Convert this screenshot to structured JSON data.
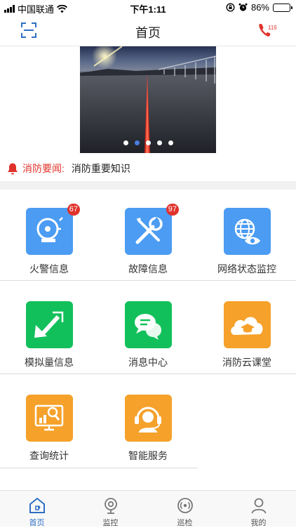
{
  "status_bar": {
    "carrier": "中国联通",
    "time": "下午1:11",
    "battery": "86%",
    "battery_level": 0.86
  },
  "nav": {
    "title": "首页",
    "phone_label": "119"
  },
  "banner": {
    "slide_count": 5,
    "active_slide": 2
  },
  "news": {
    "tag": "消防要闻:",
    "headline": "消防重要知识"
  },
  "grid": {
    "fire_alarm": {
      "label": "火警信息",
      "badge": "67"
    },
    "fault": {
      "label": "故障信息",
      "badge": "97"
    },
    "network": {
      "label": "网络状态监控"
    },
    "analog": {
      "label": "模拟量信息"
    },
    "message": {
      "label": "消息中心"
    },
    "classroom": {
      "label": "消防云课堂"
    },
    "query": {
      "label": "查询统计"
    },
    "service": {
      "label": "智能服务"
    }
  },
  "tabs": [
    {
      "label": "首页",
      "icon": "home-icon",
      "active": true
    },
    {
      "label": "监控",
      "icon": "camera-icon",
      "active": false
    },
    {
      "label": "巡检",
      "icon": "radar-icon",
      "active": false
    },
    {
      "label": "我的",
      "icon": "user-icon",
      "active": false
    }
  ],
  "colors": {
    "accent_blue": "#2f6fc4",
    "alert_red": "#e0322b",
    "tile_blue": "#4b9cf2",
    "tile_green": "#12c05b",
    "tile_orange": "#f5a12a"
  }
}
